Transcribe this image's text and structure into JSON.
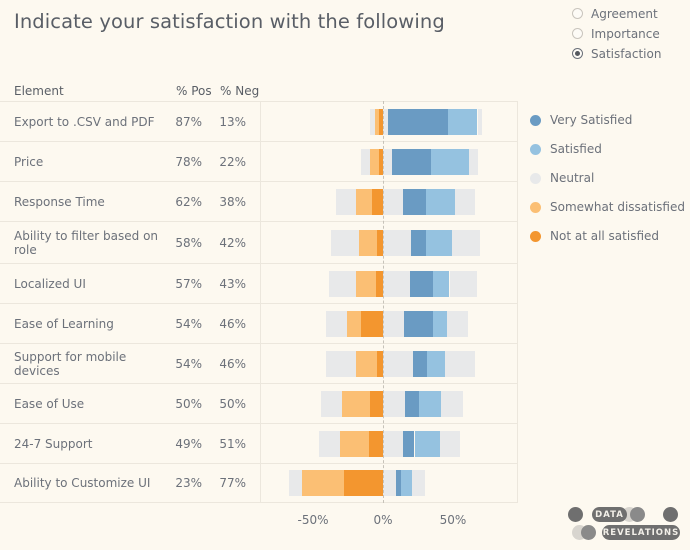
{
  "header": {
    "title": "Indicate your satisfaction with the following"
  },
  "controls": {
    "name": "survey-dimension",
    "options": [
      {
        "label": "Agreement",
        "selected": false
      },
      {
        "label": "Importance",
        "selected": false
      },
      {
        "label": "Satisfaction",
        "selected": true
      }
    ]
  },
  "table": {
    "columns": {
      "element": "Element",
      "pos": "% Pos",
      "neg": "% Neg"
    }
  },
  "legend": {
    "position": "right",
    "entries": [
      {
        "label": "Very Satisfied",
        "color": "#6a9bc3"
      },
      {
        "label": "Satisfied",
        "color": "#95c2e0"
      },
      {
        "label": "Neutral",
        "color": "#e8e9ea"
      },
      {
        "label": "Somewhat dissatisfied",
        "color": "#fbbf74"
      },
      {
        "label": "Not at all satisfied",
        "color": "#f3962f"
      }
    ]
  },
  "axis": {
    "ticks": [
      {
        "label": "-50%",
        "value": -50
      },
      {
        "label": "0%",
        "value": 0
      },
      {
        "label": "50%",
        "value": 50
      }
    ],
    "zero_label": "0%"
  },
  "logo": {
    "line1": "DATA",
    "line2": "REVELATIONS"
  },
  "chart_data": {
    "type": "bar",
    "subtype": "diverging-stacked-bar",
    "title": "Indicate your satisfaction with the following",
    "xlabel": "",
    "ylabel": "Element",
    "xlim": [
      -100,
      100
    ],
    "grid": false,
    "legend_position": "right",
    "series": [
      {
        "name": "Not at all satisfied",
        "color": "#f3962f"
      },
      {
        "name": "Somewhat dissatisfied",
        "color": "#fbbf74"
      },
      {
        "name": "Neutral",
        "color": "#e8e9ea"
      },
      {
        "name": "Satisfied",
        "color": "#95c2e0"
      },
      {
        "name": "Very Satisfied",
        "color": "#6a9bc3"
      }
    ],
    "categories": [
      "Export to .CSV and PDF",
      "Price",
      "Response Time",
      "Ability to filter based on role",
      "Localized UI",
      "Ease of Learning",
      "Support for mobile devices",
      "Ease of Use",
      "24-7 Support",
      "Ability to Customize UI"
    ],
    "rows": [
      {
        "element": "Export to .CSV and PDF",
        "pct_pos": "87%",
        "pct_neg": "13%",
        "not_at_all": 3,
        "somewhat": 3,
        "neutral": 7,
        "satisfied": 21,
        "very_satisfied": 43
      },
      {
        "element": "Price",
        "pct_pos": "78%",
        "pct_neg": "22%",
        "not_at_all": 3,
        "somewhat": 6,
        "neutral": 13,
        "satisfied": 27,
        "very_satisfied": 28
      },
      {
        "element": "Response Time",
        "pct_pos": "62%",
        "pct_neg": "38%",
        "not_at_all": 8,
        "somewhat": 11,
        "neutral": 29,
        "satisfied": 21,
        "very_satisfied": 16
      },
      {
        "element": "Ability to filter based on role",
        "pct_pos": "58%",
        "pct_neg": "42%",
        "not_at_all": 4,
        "somewhat": 13,
        "neutral": 40,
        "satisfied": 18,
        "very_satisfied": 11
      },
      {
        "element": "Localized UI",
        "pct_pos": "57%",
        "pct_neg": "43%",
        "not_at_all": 5,
        "somewhat": 14,
        "neutral": 39,
        "satisfied": 12,
        "very_satisfied": 16
      },
      {
        "element": "Ease of Learning",
        "pct_pos": "54%",
        "pct_neg": "46%",
        "not_at_all": 16,
        "somewhat": 10,
        "neutral": 30,
        "satisfied": 10,
        "very_satisfied": 21
      },
      {
        "element": "Support for mobile devices",
        "pct_pos": "54%",
        "pct_neg": "46%",
        "not_at_all": 4,
        "somewhat": 15,
        "neutral": 43,
        "satisfied": 13,
        "very_satisfied": 10
      },
      {
        "element": "Ease of Use",
        "pct_pos": "50%",
        "pct_neg": "50%",
        "not_at_all": 9,
        "somewhat": 20,
        "neutral": 31,
        "satisfied": 16,
        "very_satisfied": 10
      },
      {
        "element": "24-7 Support",
        "pct_pos": "49%",
        "pct_neg": "51%",
        "not_at_all": 10,
        "somewhat": 21,
        "neutral": 29,
        "satisfied": 18,
        "very_satisfied": 8
      },
      {
        "element": "Ability to Customize UI",
        "pct_pos": "23%",
        "pct_neg": "77%",
        "not_at_all": 28,
        "somewhat": 30,
        "neutral": 18,
        "satisfied": 8,
        "very_satisfied": 4
      }
    ]
  }
}
